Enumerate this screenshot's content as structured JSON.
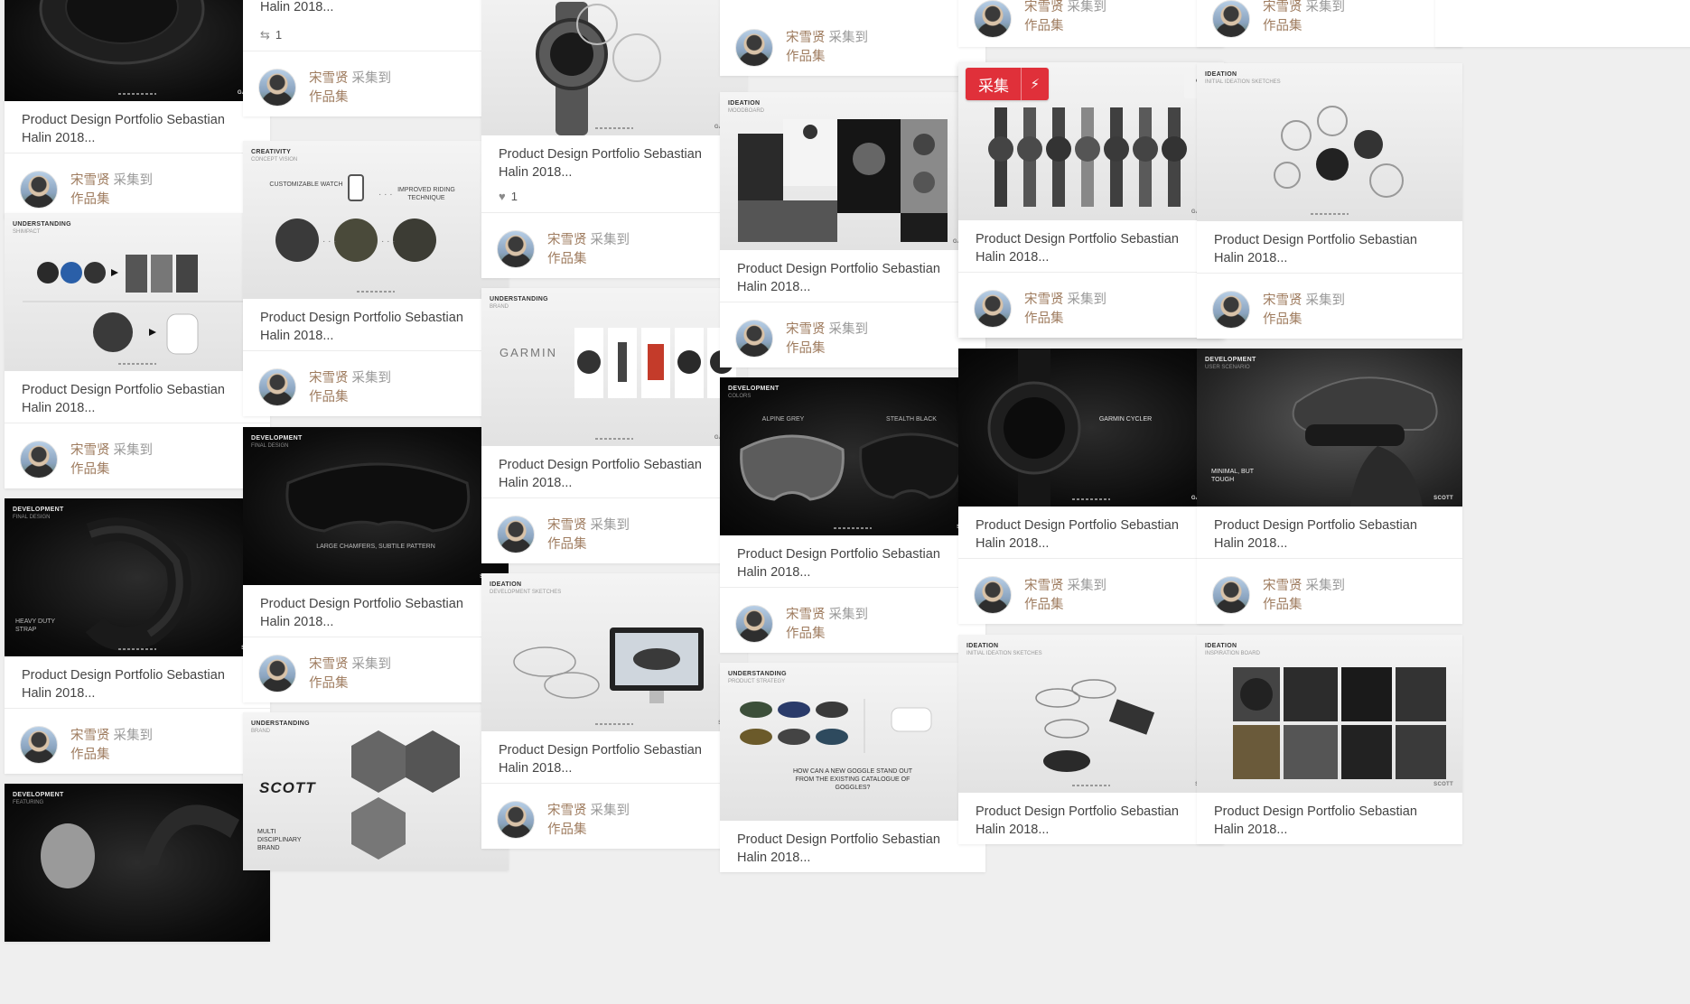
{
  "pin_title": "Product Design Portfolio Sebastian Halin 2018...",
  "collector_name": "宋雪贤",
  "collected_verb": "采集到",
  "board_name": "作品集",
  "like_count": "1",
  "repin_count": "1",
  "hover_actions": {
    "save_label": "采集",
    "bolt_icon": "lightning-icon",
    "like_icon": "heart-icon",
    "share_icon": "share-icon"
  },
  "thumb_text": {
    "understanding_shimpact": [
      "UNDERSTANDING",
      "SHIMPACT"
    ],
    "development_final": [
      "DEVELOPMENT",
      "FINAL DESIGN"
    ],
    "heavy_duty": "HEAVY DUTY STRAP",
    "development_features": [
      "DEVELOPMENT",
      "FEATURING"
    ],
    "creativity": [
      "CREATIVITY",
      "CONCEPT VISION"
    ],
    "customizable": "CUSTOMIZABLE WATCH",
    "improved": "IMPROVED RIDING TECHNIQUE",
    "large_chamfers": "LARGE CHAMFERS, SUBTILE PATTERN",
    "understanding_brand": [
      "UNDERSTANDING",
      "BRAND"
    ],
    "scott": "SCOTT",
    "multi": "MULTI DISCIPLINARY BRAND",
    "garmin": "GARMIN",
    "ideation_dev": [
      "IDEATION",
      "DEVELOPMENT SKETCHES"
    ],
    "ideation_mood": [
      "IDEATION",
      "MOODBOARD"
    ],
    "development_colors": [
      "DEVELOPMENT",
      "COLORS"
    ],
    "alpine_grey": "ALPINE GREY",
    "stealth_black": "STEALTH BLACK",
    "understanding_product": [
      "UNDERSTANDING",
      "PRODUCT STRATEGY"
    ],
    "goggle_question": "HOW CAN A NEW GOGGLE STAND OUT FROM THE EXISTING CATALOGUE OF GOGGLES?",
    "garmin_cycler": "GARMIN CYCLER",
    "ideation_initial": [
      "IDEATION",
      "INITIAL IDEATION SKETCHES"
    ],
    "development_user": [
      "DEVELOPMENT",
      "USER SCENARIO"
    ],
    "minimal": "MINIMAL, BUT TOUGH",
    "ideation_inspiration": [
      "IDEATION",
      "INSPIRATION BOARD"
    ],
    "brand_garmin": "GARMIN",
    "brand_scott": "SCOTT"
  }
}
